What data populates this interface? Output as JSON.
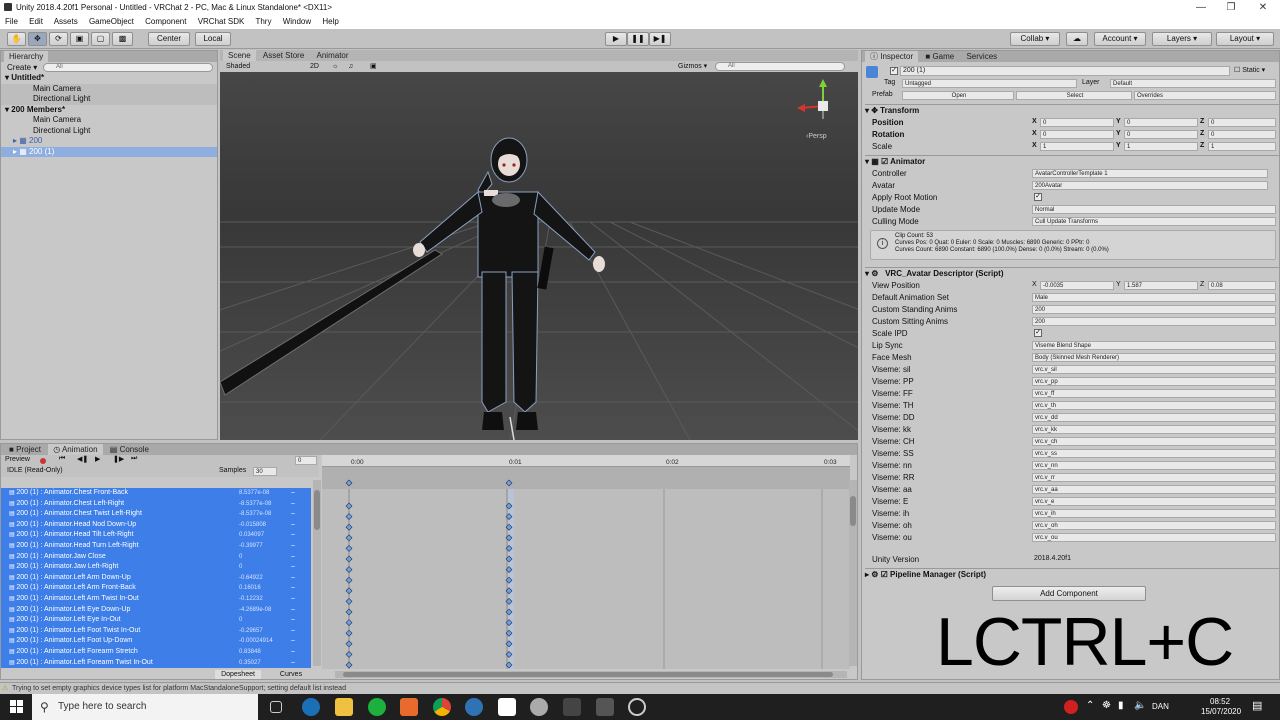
{
  "title_bar": {
    "title": "Unity 2018.4.20f1 Personal - Untitled - VRChat 2 - PC, Mac & Linux Standalone* <DX11>"
  },
  "menu": [
    "File",
    "Edit",
    "Assets",
    "GameObject",
    "Component",
    "VRChat SDK",
    "Thry",
    "Window",
    "Help"
  ],
  "toolbar": {
    "pivot": "Center",
    "space": "Local",
    "collab": "Collab ▾",
    "account": "Account ▾",
    "layers": "Layers ▾",
    "layout": "Layout ▾"
  },
  "hierarchy": {
    "tab": "Hierarchy",
    "create": "Create ▾",
    "search": "All",
    "rows": [
      "Untitled*",
      "Main Camera",
      "Directional Light",
      "200 Members*",
      "Main Camera",
      "Directional Light",
      "200",
      "200 (1)"
    ]
  },
  "scene": {
    "tabs": [
      "Scene",
      "Asset Store",
      "Animator"
    ],
    "shading": "Shaded",
    "mode2d": "2D",
    "gizmos": "Gizmos ▾",
    "search": "All",
    "persp": "‹Persp"
  },
  "inspector": {
    "tabs": [
      "Inspector",
      "Game",
      "Services"
    ],
    "object_name": "200 (1)",
    "static_label": "Static ▾",
    "tag_label": "Tag",
    "tag": "Untagged",
    "layer_label": "Layer",
    "layer": "Default",
    "prefab_label": "Prefab",
    "prefab_open": "Open",
    "prefab_select": "Select",
    "prefab_overrides": "Overrides",
    "transform": {
      "title": "Transform",
      "position_label": "Position",
      "rotation_label": "Rotation",
      "scale_label": "Scale",
      "position": [
        "0",
        "0",
        "0"
      ],
      "rotation": [
        "0",
        "0",
        "0"
      ],
      "scale": [
        "1",
        "1",
        "1"
      ]
    },
    "animator": {
      "title": "Animator",
      "controller_label": "Controller",
      "controller": "AvatarControllerTemplate 1",
      "avatar_label": "Avatar",
      "avatar": "200Avatar",
      "apply_root_label": "Apply Root Motion",
      "update_mode_label": "Update Mode",
      "update_mode": "Normal",
      "culling_mode_label": "Culling Mode",
      "culling_mode": "Cull Update Transforms",
      "info": [
        "Clip Count: 53",
        "Curves Pos: 0 Quat: 0 Euler: 0 Scale: 0 Muscles: 6890 Generic: 0 PPtr: 0",
        "Curves Count: 6890 Constant: 6890 (100.0%) Dense: 0 (0.0%) Stream: 0 (0.0%)"
      ]
    },
    "descriptor": {
      "title": "VRC_Avatar Descriptor (Script)",
      "view_position_label": "View Position",
      "view_position": [
        "-0.0035",
        "1.587",
        "0.08"
      ],
      "rows": [
        {
          "label": "Default Animation Set",
          "value": "Male"
        },
        {
          "label": "Custom Standing Anims",
          "value": "200"
        },
        {
          "label": "Custom Sitting Anims",
          "value": "200"
        },
        {
          "label": "Scale IPD",
          "value": ""
        },
        {
          "label": "Lip Sync",
          "value": "Viseme Blend Shape"
        },
        {
          "label": "Face Mesh",
          "value": "Body (Skinned Mesh Renderer)"
        },
        {
          "label": "Viseme: sil",
          "value": "vrc.v_sil"
        },
        {
          "label": "Viseme: PP",
          "value": "vrc.v_pp"
        },
        {
          "label": "Viseme: FF",
          "value": "vrc.v_ff"
        },
        {
          "label": "Viseme: TH",
          "value": "vrc.v_th"
        },
        {
          "label": "Viseme: DD",
          "value": "vrc.v_dd"
        },
        {
          "label": "Viseme: kk",
          "value": "vrc.v_kk"
        },
        {
          "label": "Viseme: CH",
          "value": "vrc.v_ch"
        },
        {
          "label": "Viseme: SS",
          "value": "vrc.v_ss"
        },
        {
          "label": "Viseme: nn",
          "value": "vrc.v_nn"
        },
        {
          "label": "Viseme: RR",
          "value": "vrc.v_rr"
        },
        {
          "label": "Viseme: aa",
          "value": "vrc.v_aa"
        },
        {
          "label": "Viseme: E",
          "value": "vrc.v_e"
        },
        {
          "label": "Viseme: ih",
          "value": "vrc.v_ih"
        },
        {
          "label": "Viseme: oh",
          "value": "vrc.v_oh"
        },
        {
          "label": "Viseme: ou",
          "value": "vrc.v_ou"
        }
      ],
      "unity_version_label": "Unity Version",
      "unity_version": "2018.4.20f1"
    },
    "pipeline": {
      "title": "Pipeline Manager (Script)"
    },
    "add_component": "Add Component"
  },
  "overlay_text": "LCTRL+C",
  "animation": {
    "tabs": [
      "Project",
      "Animation",
      "Console"
    ],
    "preview": "Preview",
    "frame": "0",
    "clip": "IDLE (Read-Only)",
    "samples_label": "Samples",
    "samples": "30",
    "time_labels": [
      "0:00",
      "0:01",
      "0:02",
      "0:03"
    ],
    "properties": [
      {
        "name": "200 (1) : Animator.Chest Front-Back",
        "value": "8.5377e-08"
      },
      {
        "name": "200 (1) : Animator.Chest Left-Right",
        "value": "-8.5377e-08"
      },
      {
        "name": "200 (1) : Animator.Chest Twist Left-Right",
        "value": "-8.5377e-08"
      },
      {
        "name": "200 (1) : Animator.Head Nod Down-Up",
        "value": "-0.015808"
      },
      {
        "name": "200 (1) : Animator.Head Tilt Left-Right",
        "value": "0.034097"
      },
      {
        "name": "200 (1) : Animator.Head Turn Left-Right",
        "value": "-0.39977"
      },
      {
        "name": "200 (1) : Animator.Jaw Close",
        "value": "0"
      },
      {
        "name": "200 (1) : Animator.Jaw Left-Right",
        "value": "0"
      },
      {
        "name": "200 (1) : Animator.Left Arm Down-Up",
        "value": "-0.64922"
      },
      {
        "name": "200 (1) : Animator.Left Arm Front-Back",
        "value": "0.16016"
      },
      {
        "name": "200 (1) : Animator.Left Arm Twist In-Out",
        "value": "-0.12232"
      },
      {
        "name": "200 (1) : Animator.Left Eye Down-Up",
        "value": "-4.2689e-08"
      },
      {
        "name": "200 (1) : Animator.Left Eye In-Out",
        "value": "0"
      },
      {
        "name": "200 (1) : Animator.Left Foot Twist In-Out",
        "value": "-0.29657"
      },
      {
        "name": "200 (1) : Animator.Left Foot Up-Down",
        "value": "-0.00024914"
      },
      {
        "name": "200 (1) : Animator.Left Forearm Stretch",
        "value": "0.83848"
      },
      {
        "name": "200 (1) : Animator.Left Forearm Twist In-Out",
        "value": "0.35027"
      }
    ],
    "bottom_tabs": [
      "Dopesheet",
      "Curves"
    ]
  },
  "status": "Trying to set empty graphics device types list for platform MacStandaloneSupport; setting default list instead",
  "taskbar": {
    "search": "Type here to search",
    "lang": "DAN",
    "time": "08:52",
    "date": "15/07/2020"
  },
  "colors": {
    "selection": "#3d7ee8",
    "accent": "#3a72d8"
  }
}
